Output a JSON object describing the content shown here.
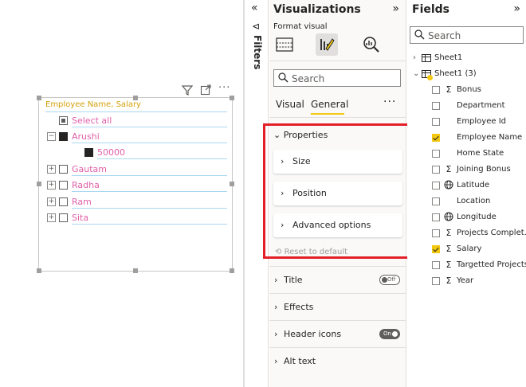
{
  "slicer": {
    "header": "Employee Name, Salary",
    "rows": [
      {
        "label": "Select all"
      },
      {
        "expander": "−",
        "label": "Arushi"
      },
      {
        "label": "50000"
      },
      {
        "expander": "+",
        "label": "Gautam"
      },
      {
        "expander": "+",
        "label": "Radha"
      },
      {
        "expander": "+",
        "label": "Ram"
      },
      {
        "expander": "+",
        "label": "Sita"
      }
    ],
    "more_symbol": "···"
  },
  "filters": {
    "label": "Filters",
    "collapse_symbol": "«",
    "funnel_symbol": "⊲"
  },
  "visualizations": {
    "title": "Visualizations",
    "expand_symbol": "»",
    "subtitle": "Format visual",
    "search_placeholder": "Search",
    "tabs": {
      "visual": "Visual",
      "general": "General"
    },
    "more_symbol": "···",
    "properties": {
      "heading": "Properties",
      "cards": [
        "Size",
        "Position",
        "Advanced options"
      ],
      "reset": "Reset to default"
    },
    "sections": [
      {
        "title": "Title",
        "toggle": "Off"
      },
      {
        "title": "Effects"
      },
      {
        "title": "Header icons",
        "toggle": "On"
      },
      {
        "title": "Alt text"
      }
    ],
    "chevron_right": "›",
    "chevron_down": "⌄"
  },
  "fields": {
    "title": "Fields",
    "expand_symbol": "»",
    "search_placeholder": "Search",
    "tables": [
      {
        "name": "Sheet1",
        "state": "collapsed"
      },
      {
        "name": "Sheet1 (3)",
        "state": "expanded"
      }
    ],
    "items": [
      {
        "name": "Bonus",
        "type": "Σ",
        "checked": false
      },
      {
        "name": "Department",
        "type": "",
        "checked": false
      },
      {
        "name": "Employee Id",
        "type": "",
        "checked": false
      },
      {
        "name": "Employee Name",
        "type": "",
        "checked": true
      },
      {
        "name": "Home State",
        "type": "",
        "checked": false
      },
      {
        "name": "Joining Bonus",
        "type": "Σ",
        "checked": false
      },
      {
        "name": "Latitude",
        "type": "globe",
        "checked": false
      },
      {
        "name": "Location",
        "type": "",
        "checked": false
      },
      {
        "name": "Longitude",
        "type": "globe",
        "checked": false
      },
      {
        "name": "Projects Complet...",
        "type": "Σ",
        "checked": false
      },
      {
        "name": "Salary",
        "type": "Σ",
        "checked": true
      },
      {
        "name": "Targetted Projects",
        "type": "Σ",
        "checked": false
      },
      {
        "name": "Year",
        "type": "Σ",
        "checked": false
      }
    ]
  },
  "colors": {
    "accent_yellow": "#f2c811",
    "highlight_red": "#e32027",
    "slicer_text_pink": "#e05fa8",
    "slicer_header_gold": "#d4a10c"
  }
}
